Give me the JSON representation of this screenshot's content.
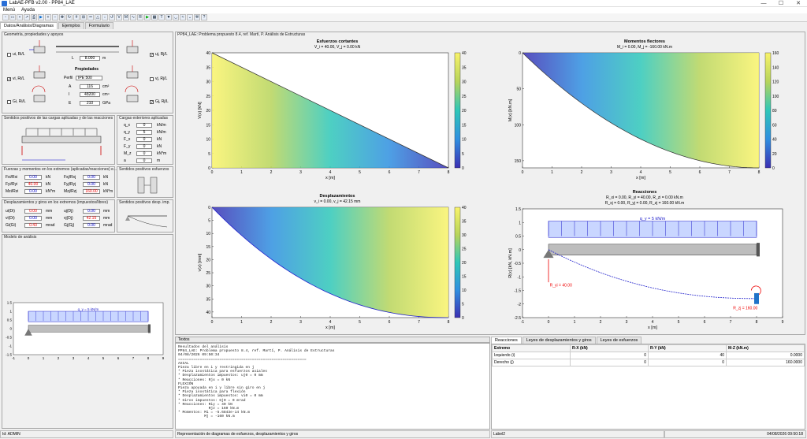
{
  "window": {
    "title": "LabAE-PFB v2.00 - PP84_LAE",
    "minimize": "—",
    "maximize": "☐",
    "close": "✕"
  },
  "menu": [
    "Menú",
    "Ayuda"
  ],
  "tabs": [
    "Datos/Análisis/Diagramas",
    "Ejemplos",
    "Formulario"
  ],
  "geom": {
    "title": "Geometría, propiedades y apoyos",
    "L_label": "L",
    "L_value": "8.000",
    "L_unit": "m",
    "props_title": "Propiedades",
    "perfil_label": "Perfil",
    "perfil_value": "IPE 500",
    "A_label": "A",
    "A_value": "116",
    "A_unit": "cm²",
    "I_label": "I",
    "I_value": "48200",
    "I_unit": "cm⁴",
    "E_label": "E",
    "E_value": "210",
    "E_unit": "GPa",
    "chk_ui": "ui, Ri/L",
    "chk_vi": "vi, Ri/L",
    "chk_gi": "Gi, Ri/L",
    "chk_uj": "uj, Rj/L",
    "chk_vj": "vj, Rj/L",
    "chk_gj": "Gj, Rj/L"
  },
  "loads_sign": {
    "title": "Sentidos positivos de las cargas aplicadas y de las reacciones"
  },
  "loads": {
    "title": "Cargas exteriores aplicadas",
    "rows": [
      {
        "sym": "q_x",
        "val": "0",
        "unit": "kN/m"
      },
      {
        "sym": "q_y",
        "val": "5",
        "unit": "kN/m"
      },
      {
        "sym": "F_x",
        "val": "0",
        "unit": "kN"
      },
      {
        "sym": "F_y",
        "val": "0",
        "unit": "kN"
      },
      {
        "sym": "M_z",
        "val": "0",
        "unit": "kN*m"
      },
      {
        "sym": "a",
        "val": "0",
        "unit": "m"
      }
    ]
  },
  "forces": {
    "title": "Fuerzas y momentos en los extremos (aplicadas/reacciones) e...",
    "rows": [
      {
        "l1": "Fxi/Rxi",
        "v1": "0.00",
        "u1": "kN",
        "l2": "Fxj/Rxj",
        "v2": "0.00",
        "u2": "kN"
      },
      {
        "l1": "Fyi/Ryi",
        "v1": "40.00",
        "u1": "kN",
        "l2": "Fyj/Ryj",
        "v2": "0.00",
        "u2": "kN"
      },
      {
        "l1": "Mzi/Rzi",
        "v1": "0.00",
        "u1": "kN*m",
        "l2": "Mzj/Rzj",
        "v2": "160.00",
        "u2": "kN*m"
      }
    ]
  },
  "efforts_sign": {
    "title": "Sentidos positivos esfuerzos"
  },
  "disp": {
    "title": "Desplazamientos y giros en los extremos (impuestos/libres)",
    "rows": [
      {
        "l1": "ui(Di)",
        "v1": "0.00",
        "u1": "mm",
        "l2": "uj(Dj)",
        "v2": "0.00",
        "u2": "mm"
      },
      {
        "l1": "vi(Di)",
        "v1": "0.00",
        "u1": "mm",
        "l2": "vj(Dj)",
        "v2": "42.15",
        "u2": "mm"
      },
      {
        "l1": "Gi(Gi)",
        "v1": "0.43",
        "u1": "mrad",
        "l2": "Gj(Gj)",
        "v2": "0.00",
        "u2": "mrad"
      }
    ]
  },
  "disp_sign": {
    "title": "Sentidos positivos desp. imp."
  },
  "model": {
    "title": "Modelo de análisis",
    "load_label": "q_y = 5 kN/m"
  },
  "plot_panel_title": "PP84_LAE: Problema propuesto 8.4, ref. Martí, P. Análisis de Estructuras",
  "plots": {
    "shear": {
      "title": "Esfuerzos cortantes",
      "sub": "V_i = 40.00, V_j = 0.00 kN",
      "ylabel": "V(x) [kN]",
      "xlabel": "x [m]"
    },
    "moment": {
      "title": "Momentos flectores",
      "sub": "M_i = 0.00, M_j = -160.00 kN.m",
      "ylabel": "M(x) [kN.m]",
      "xlabel": "x [m]"
    },
    "disp": {
      "title": "Desplazamientos",
      "sub": "v_i = 0.00, v_j = 42.15 mm",
      "ylabel": "v(x) [mm]",
      "xlabel": "x [m]"
    },
    "react": {
      "title": "Reacciones",
      "sub1": "R_xi = 0.00, R_yi = 40.00, R_zi = 0.00 kN.m",
      "sub2": "R_xj = 0.00, R_yj = 0.00, R_zj = 160.00 kN.m",
      "ylabel": "R(x) [kN, kN.m]",
      "xlabel": "x [m]",
      "q_label": "q_y = 5 kN/m",
      "ryi_label": "R_yi = 40.00",
      "rzj_label": "R_zj = 160.00"
    }
  },
  "chart_data": [
    {
      "type": "area",
      "title": "Esfuerzos cortantes",
      "xlabel": "x [m]",
      "ylabel": "V(x) [kN]",
      "x": [
        0,
        8
      ],
      "y": [
        40,
        0
      ],
      "xlim": [
        0,
        8
      ],
      "ylim": [
        0,
        40
      ],
      "colorbar": [
        0,
        40
      ]
    },
    {
      "type": "area",
      "title": "Momentos flectores",
      "xlabel": "x [m]",
      "ylabel": "M(x) [kN.m]",
      "x": [
        0,
        2,
        4,
        6,
        8
      ],
      "y": [
        0,
        -70,
        -120,
        -150,
        -160
      ],
      "xlim": [
        0,
        8
      ],
      "ylim": [
        0,
        160
      ],
      "colorbar": [
        0,
        160
      ]
    },
    {
      "type": "area",
      "title": "Desplazamientos",
      "xlabel": "x [m]",
      "ylabel": "v(x) [mm]",
      "x": [
        0,
        2,
        4,
        6,
        8
      ],
      "y": [
        0,
        18.6,
        31.6,
        39.5,
        42.15
      ],
      "xlim": [
        0,
        8
      ],
      "ylim": [
        0,
        40
      ],
      "colorbar": [
        0,
        40
      ]
    },
    {
      "type": "line",
      "title": "Reacciones",
      "xlabel": "x [m]",
      "ylabel": "R(x) [kN, kN.m]",
      "xlim": [
        -1,
        9
      ],
      "ylim": [
        -2.5,
        1.5
      ]
    }
  ],
  "results_tab": "Textos",
  "results_text": "Resultados del análisis\nPP84_LAE: Problema propuesto 8.4, ref. Martí, P. Análisis de Estructuras\n04/08/2026 09:50:34\n===========================================================\nAXIAL\nPieza libre en i y restringida en j\n* Pieza isostática para esfuerzos axiales\n* Desplazamientos impuestos: uj0 = 0 mm\n* Reacciones: Rjx = 0 kN\nFLEXIÓN\nPieza apoyada en i y libre sin giro en j\n* Pieza isostática para flexión\n* Desplazamientos impuestos: vi0 = 0 mm\n* Giros impuestos: Gj0 = 0 mrad\n* Reacciones: Riy = 40 kN\n              Rjz = 160 kN.m\n* Momentos: Mi = -5.6843e-14 kN.m\n            Mj = -160 kN.m",
  "table_tabs": [
    "Reacciones",
    "Leyes de desplazamientos y giros",
    "Leyes de esfuerzos"
  ],
  "table": {
    "headers": [
      "Extremo",
      "R-X (kN)",
      "R-Y (kN)",
      "M-Z (kN.m)"
    ],
    "rows": [
      [
        "Izquierdo (i)",
        "0",
        "40",
        "0.0000"
      ],
      [
        "Derecho (j)",
        "0",
        "0",
        "160.0000"
      ]
    ]
  },
  "status": {
    "user": "Id: ADMIN",
    "middle": "Representación de diagramas de esfuerzos, desplazamientos y giros",
    "label": "Label2",
    "datetime": "04/08/2026 09:50:18"
  }
}
